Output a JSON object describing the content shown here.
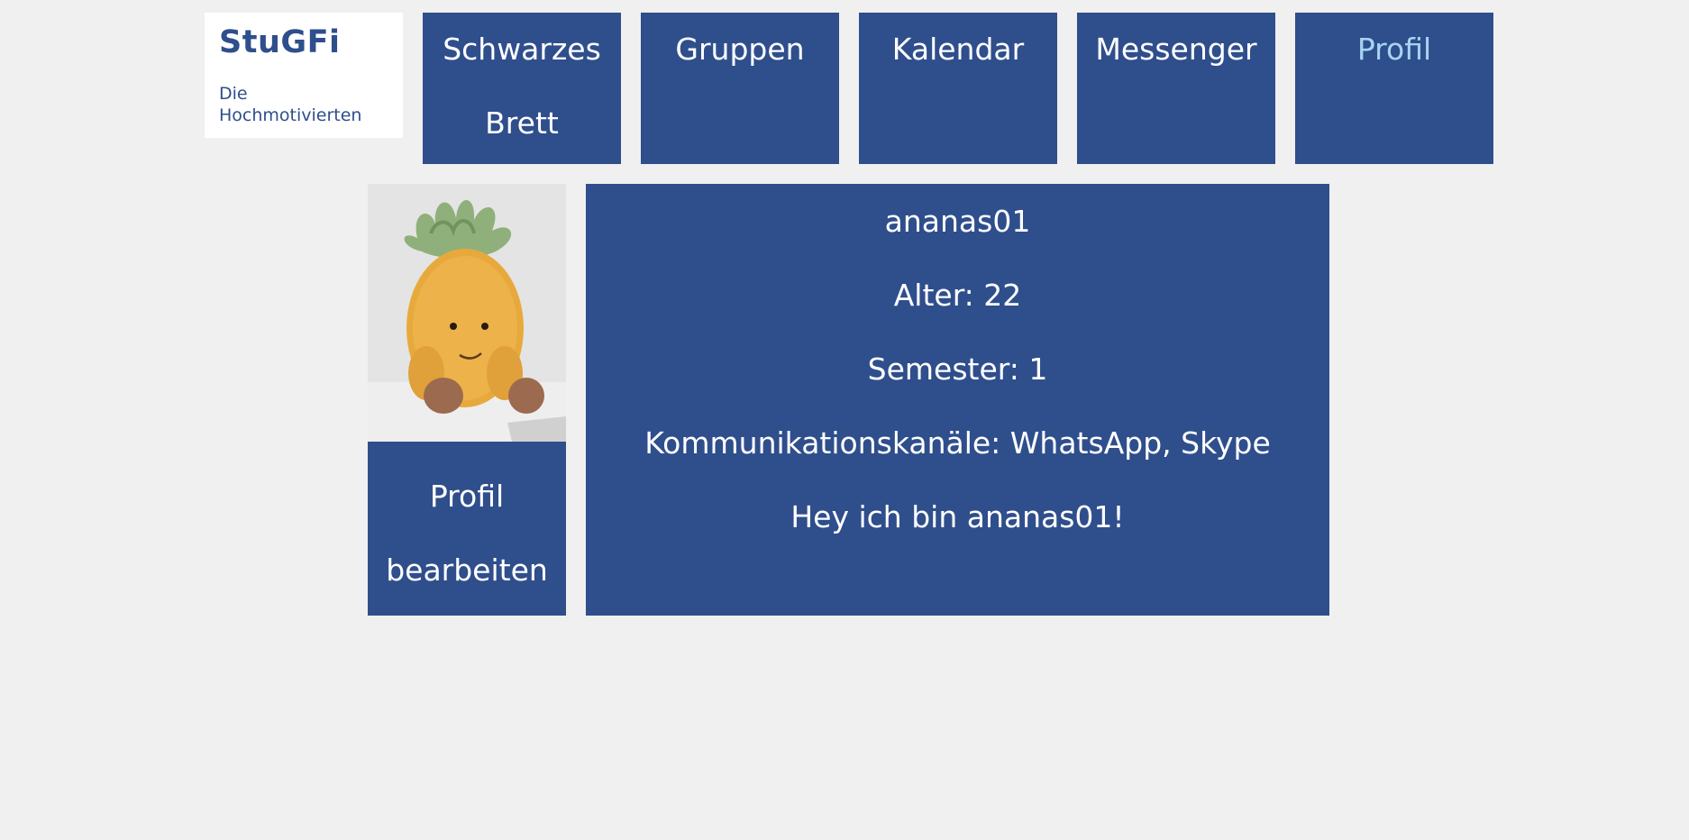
{
  "logo": {
    "title": "StuGFi",
    "tagline": "Die Hochmotivierten"
  },
  "nav": {
    "items": [
      {
        "label": "Schwarzes Brett"
      },
      {
        "label": "Gruppen"
      },
      {
        "label": "Kalendar"
      },
      {
        "label": "Messenger"
      },
      {
        "label": "Profil",
        "active": true
      }
    ]
  },
  "profile": {
    "avatar_icon": "pineapple-plush-image",
    "edit_button_label": "Profil bearbeiten",
    "username": "ananas01",
    "age": "Alter: 22",
    "semester": "Semester: 1",
    "channels": "Kommunikationskanäle: WhatsApp, Skype",
    "bio": "Hey ich bin ananas01!"
  },
  "colors": {
    "background": "#f0f0f0",
    "tile": "#2f4e8c",
    "active_nav_text": "#a7d4f2",
    "text": "#ffffff"
  }
}
